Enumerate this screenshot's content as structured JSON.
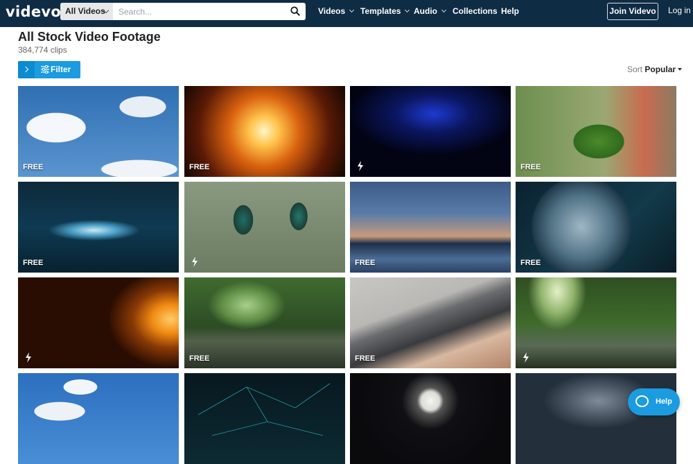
{
  "header": {
    "logo": "videvo",
    "search_scope": "All Videos",
    "search_placeholder": "Search...",
    "nav": [
      {
        "label": "Videos",
        "has_menu": true
      },
      {
        "label": "Templates",
        "has_menu": true
      },
      {
        "label": "Audio",
        "has_menu": true
      },
      {
        "label": "Collections",
        "has_menu": false
      },
      {
        "label": "Help",
        "has_menu": false
      }
    ],
    "join_label": "Join Videvo",
    "login_label": "Log in"
  },
  "page": {
    "title": "All Stock Video Footage",
    "count": "384,774 clips",
    "filter_label": "Filter",
    "sort_label": "Sort",
    "sort_value": "Popular"
  },
  "colors": {
    "header_bg": "#0f2c45",
    "accent": "#1b9be0"
  },
  "tiles": [
    {
      "subject": "blue sky with clouds",
      "badge": "FREE"
    },
    {
      "subject": "orange explosion",
      "badge": "FREE"
    },
    {
      "subject": "blue particles in space",
      "badge": "lightning"
    },
    {
      "subject": "green leaves in rain",
      "badge": "FREE"
    },
    {
      "subject": "blue wave particles",
      "badge": "FREE"
    },
    {
      "subject": "hummingbirds on branch",
      "badge": "lightning"
    },
    {
      "subject": "sunset over lake with clouds",
      "badge": "FREE"
    },
    {
      "subject": "earth globe",
      "badge": "FREE"
    },
    {
      "subject": "golden particles",
      "badge": "lightning"
    },
    {
      "subject": "rain drops in forest",
      "badge": "FREE"
    },
    {
      "subject": "typing on laptop",
      "badge": "FREE"
    },
    {
      "subject": "forest stream",
      "badge": "lightning"
    },
    {
      "subject": "sky with clouds",
      "badge": ""
    },
    {
      "subject": "network lines",
      "badge": ""
    },
    {
      "subject": "moon over clouds",
      "badge": ""
    },
    {
      "subject": "storm clouds",
      "badge": ""
    }
  ],
  "help_fab": "Help"
}
